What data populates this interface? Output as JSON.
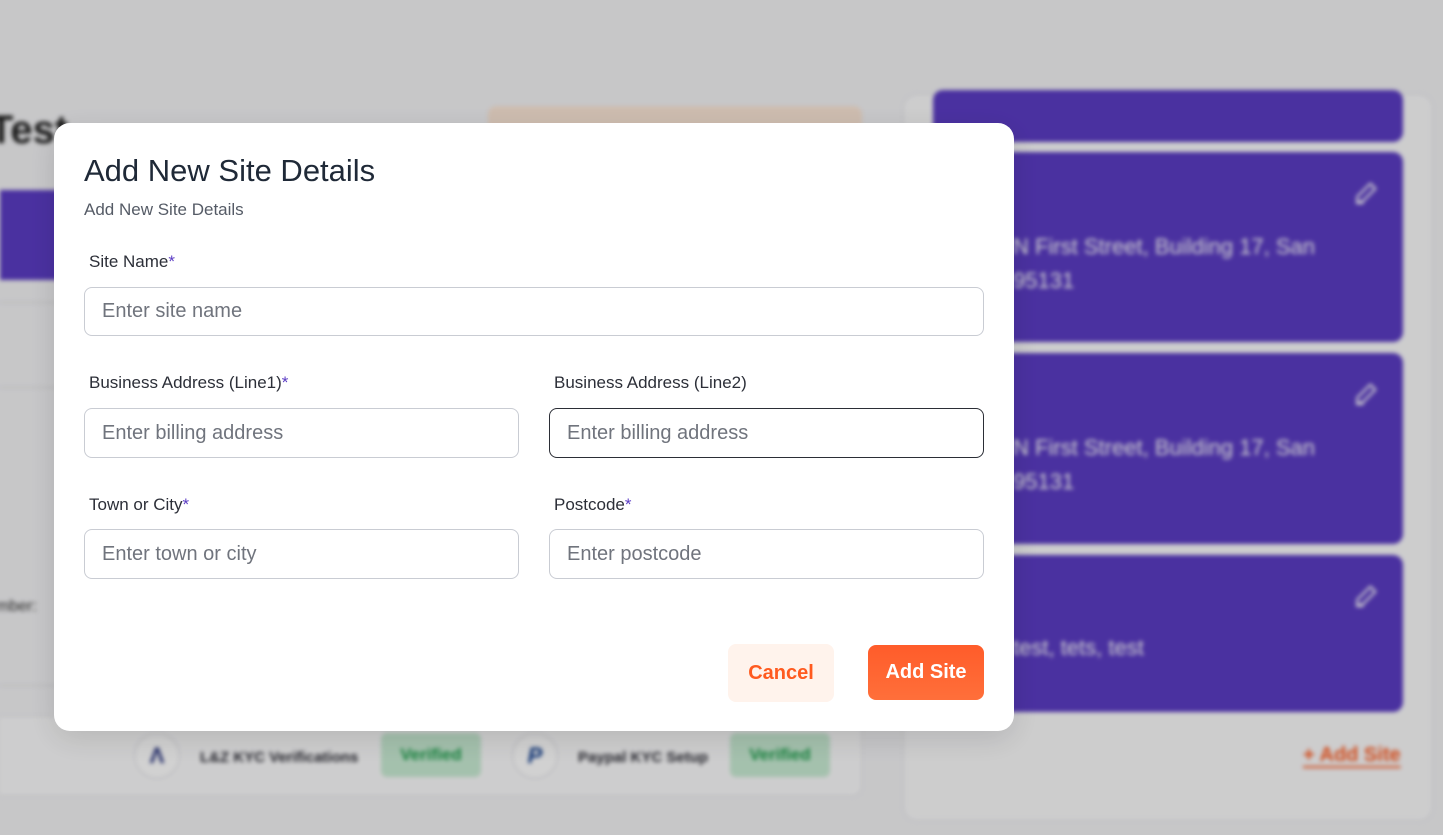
{
  "background": {
    "page_title_fragment": "nt Test",
    "number_label_fragment": "mber:",
    "kyc": [
      {
        "logo_glyph": "Λ",
        "label": "L&Z KYC Verifications",
        "status": "Verified"
      },
      {
        "logo_glyph": "P",
        "label": "Paypal KYC Setup",
        "status": "Verified"
      }
    ],
    "sites": [
      {
        "address_line1": "N First Street, Building 17, San",
        "address_line2": "95131"
      },
      {
        "address_line1": "N First Street, Building 17, San",
        "address_line2": "95131"
      },
      {
        "address_line1": "test, tets, test",
        "address_line2": ""
      }
    ],
    "add_site_link": "+ Add Site"
  },
  "modal": {
    "title": "Add New Site Details",
    "subtitle": "Add New Site Details",
    "site_name": {
      "label": "Site Name",
      "required_mark": "*",
      "placeholder": "Enter site name",
      "value": ""
    },
    "address_line1": {
      "label": "Business Address (Line1)",
      "required_mark": "*",
      "placeholder": "Enter billing address",
      "value": ""
    },
    "address_line2": {
      "label": "Business Address (Line2)",
      "placeholder": "Enter billing address",
      "value": ""
    },
    "town": {
      "label": "Town or City",
      "required_mark": "*",
      "placeholder": "Enter town or city",
      "value": ""
    },
    "postcode": {
      "label": "Postcode",
      "required_mark": "*",
      "placeholder": "Enter postcode",
      "value": ""
    },
    "cancel_label": "Cancel",
    "submit_label": "Add Site"
  },
  "colors": {
    "accent_purple": "#5b3cc4",
    "accent_orange": "#ff5a1f",
    "verified_green": "#1b9d4a"
  }
}
